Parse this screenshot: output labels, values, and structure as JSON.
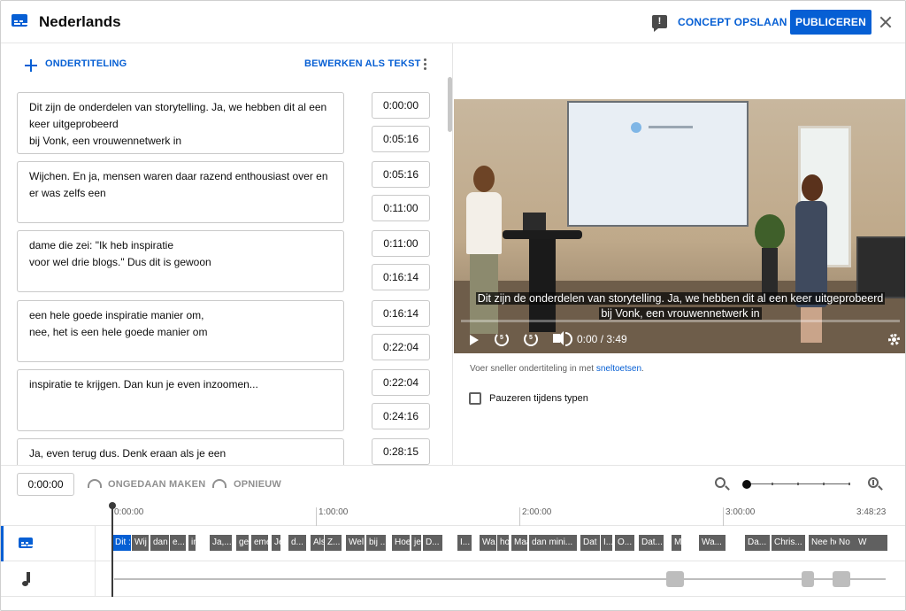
{
  "header": {
    "title": "Nederlands",
    "draft_label": "CONCEPT OPSLAAN",
    "publish_label": "PUBLICEREN",
    "feedback_glyph": "!"
  },
  "editor": {
    "add_subtitle_label": "ONDERTITELING",
    "edit_as_text_label": "BEWERKEN ALS TEKST",
    "cues": [
      {
        "lines": [
          "Dit zijn de onderdelen van storytelling. Ja, we hebben dit al een",
          "keer uitgeprobeerd",
          "bij Vonk, een vrouwennetwerk in"
        ],
        "start": "0:00:00",
        "end": "0:05:16"
      },
      {
        "lines": [
          "Wijchen. En ja, mensen waren daar razend enthousiast over en",
          "er was zelfs een",
          ""
        ],
        "start": "0:05:16",
        "end": "0:11:00"
      },
      {
        "lines": [
          "dame die zei: \"Ik heb inspiratie",
          "voor wel drie blogs.\" Dus dit is gewoon",
          ""
        ],
        "start": "0:11:00",
        "end": "0:16:14"
      },
      {
        "lines": [
          "een hele goede inspiratie manier om,",
          "nee, het is een hele goede manier om",
          ""
        ],
        "start": "0:16:14",
        "end": "0:22:04"
      },
      {
        "lines": [
          "inspiratie te krijgen. Dan kun je even inzoomen...",
          "",
          ""
        ],
        "start": "0:22:04",
        "end": "0:24:16"
      },
      {
        "lines": [
          "Ja, even terug dus.  Denk eraan als je een",
          "",
          ""
        ],
        "start": "0:28:15",
        "end": ""
      }
    ]
  },
  "player": {
    "subtitle_line1": "Dit zijn de onderdelen van storytelling. Ja, we hebben dit al een keer uitgeprobeerd",
    "subtitle_line2": "bij Vonk, een vrouwennetwerk in",
    "time_display": "0:00 / 3:49",
    "progress": 0.0,
    "rewind_glyph": "5",
    "forward_glyph": "5"
  },
  "options": {
    "shortcut_prefix": "Voer sneller ondertiteling in met ",
    "shortcut_link": "sneltoetsen",
    "shortcut_suffix": ".",
    "pause_label": "Pauzeren tijdens typen",
    "pause_checked": false
  },
  "timeline": {
    "current_time": "0:00:00",
    "undo_label": "ONGEDAAN MAKEN",
    "redo_label": "OPNIEUW",
    "ruler": [
      "0:00:00",
      "1:00:00",
      "2:00:00",
      "3:00:00",
      "3:48:23"
    ],
    "chips": [
      "Dit :",
      "Wij",
      "dan",
      "e...",
      "in",
      "Ja,...",
      "ge",
      "eme",
      "Je",
      "d...",
      "Als",
      "Z...",
      "Wel",
      "bij ...",
      "Hoe",
      "je",
      "D...",
      "I...",
      "Wa",
      "ho",
      "Maa",
      "dan mini...",
      "Dat",
      "I...",
      "O...",
      "Dat...",
      "M",
      "Wa...",
      "Da...",
      "Chris...",
      "Nee hoor...",
      "No",
      "W"
    ]
  },
  "colors": {
    "accent": "#065fd4",
    "chip": "#606060"
  },
  "icons": [
    "subtitles-icon",
    "feedback-icon",
    "close-icon",
    "plus-icon",
    "more-vert-icon",
    "play-icon",
    "rewind-icon",
    "forward-icon",
    "volume-icon",
    "gear-icon",
    "undo-icon",
    "redo-icon",
    "zoom-out-icon",
    "zoom-in-icon",
    "music-note-icon"
  ]
}
